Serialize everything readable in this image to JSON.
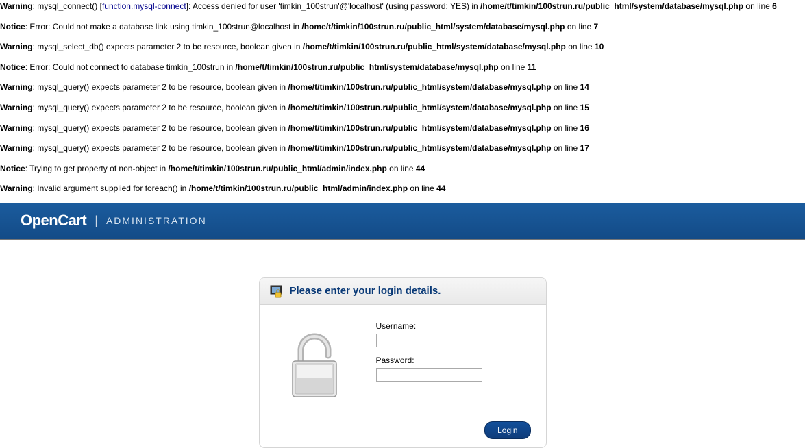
{
  "errors": [
    {
      "level": "Warning",
      "before": ": mysql_connect() [",
      "linkText": "function.mysql-connect",
      "after": "]: Access denied for user 'timkin_100strun'@'localhost' (using password: YES) in ",
      "file": "/home/t/timkin/100strun.ru/public_html/system/database/mysql.php",
      "onLine": " on line ",
      "line": "6"
    },
    {
      "level": "Notice",
      "before": ": Error: Could not make a database link using timkin_100strun@localhost in ",
      "linkText": "",
      "after": "",
      "file": "/home/t/timkin/100strun.ru/public_html/system/database/mysql.php",
      "onLine": " on line ",
      "line": "7"
    },
    {
      "level": "Warning",
      "before": ": mysql_select_db() expects parameter 2 to be resource, boolean given in ",
      "linkText": "",
      "after": "",
      "file": "/home/t/timkin/100strun.ru/public_html/system/database/mysql.php",
      "onLine": " on line ",
      "line": "10"
    },
    {
      "level": "Notice",
      "before": ": Error: Could not connect to database timkin_100strun in ",
      "linkText": "",
      "after": "",
      "file": "/home/t/timkin/100strun.ru/public_html/system/database/mysql.php",
      "onLine": " on line ",
      "line": "11"
    },
    {
      "level": "Warning",
      "before": ": mysql_query() expects parameter 2 to be resource, boolean given in ",
      "linkText": "",
      "after": "",
      "file": "/home/t/timkin/100strun.ru/public_html/system/database/mysql.php",
      "onLine": " on line ",
      "line": "14"
    },
    {
      "level": "Warning",
      "before": ": mysql_query() expects parameter 2 to be resource, boolean given in ",
      "linkText": "",
      "after": "",
      "file": "/home/t/timkin/100strun.ru/public_html/system/database/mysql.php",
      "onLine": " on line ",
      "line": "15"
    },
    {
      "level": "Warning",
      "before": ": mysql_query() expects parameter 2 to be resource, boolean given in ",
      "linkText": "",
      "after": "",
      "file": "/home/t/timkin/100strun.ru/public_html/system/database/mysql.php",
      "onLine": " on line ",
      "line": "16"
    },
    {
      "level": "Warning",
      "before": ": mysql_query() expects parameter 2 to be resource, boolean given in ",
      "linkText": "",
      "after": "",
      "file": "/home/t/timkin/100strun.ru/public_html/system/database/mysql.php",
      "onLine": " on line ",
      "line": "17"
    },
    {
      "level": "Notice",
      "before": ": Trying to get property of non-object in ",
      "linkText": "",
      "after": "",
      "file": "/home/t/timkin/100strun.ru/public_html/admin/index.php",
      "onLine": " on line ",
      "line": "44"
    },
    {
      "level": "Warning",
      "before": ": Invalid argument supplied for foreach() in ",
      "linkText": "",
      "after": "",
      "file": "/home/t/timkin/100strun.ru/public_html/admin/index.php",
      "onLine": " on line ",
      "line": "44"
    }
  ],
  "header": {
    "brand": "OpenCart",
    "administration": "ADMINISTRATION"
  },
  "login": {
    "title": "Please enter your login details.",
    "usernameLabel": "Username:",
    "passwordLabel": "Password:",
    "usernameValue": "",
    "passwordValue": "",
    "loginButton": "Login"
  }
}
